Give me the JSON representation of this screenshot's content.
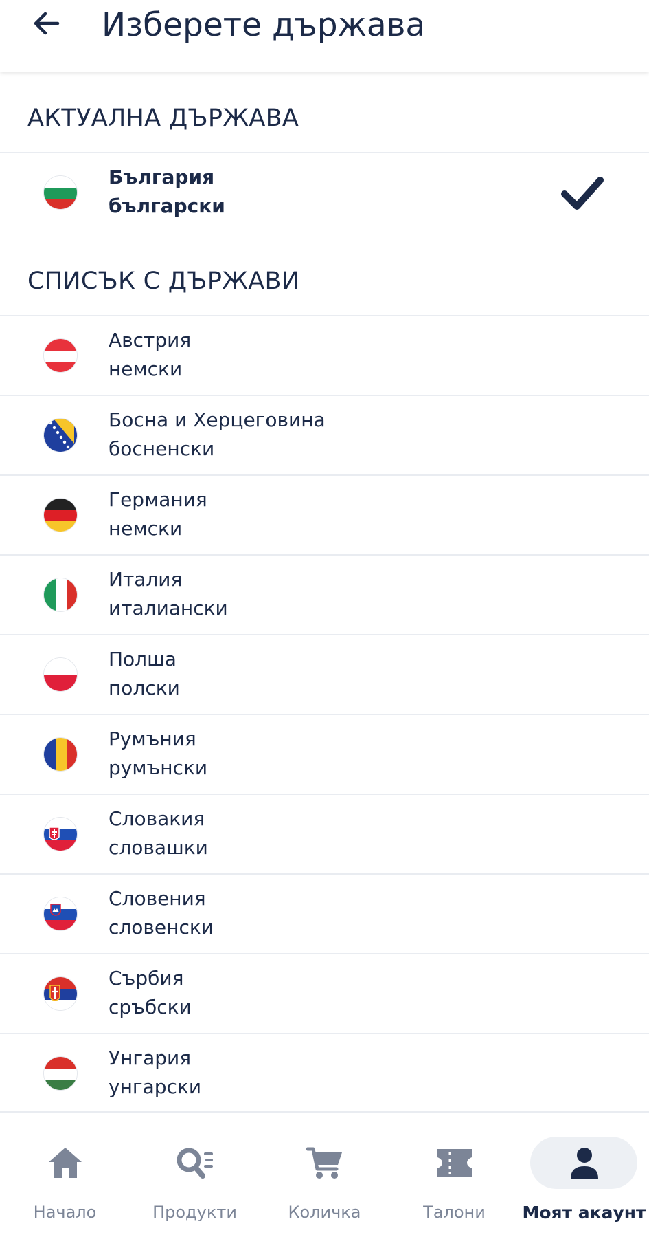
{
  "header": {
    "title": "Изберете държава",
    "back_icon": "arrow-left-icon"
  },
  "current_section": {
    "title": "АКТУАЛНА ДЪРЖАВА",
    "country": {
      "name": "България",
      "language": "български",
      "flag": "flag-bulgaria-icon",
      "selected_icon": "checkmark-icon"
    }
  },
  "list_section": {
    "title": "СПИСЪК С ДЪРЖАВИ",
    "countries": [
      {
        "name": "Австрия",
        "language": "немски",
        "flag": "flag-austria-icon"
      },
      {
        "name": "Босна и Херцеговина",
        "language": "босненски",
        "flag": "flag-bosnia-icon"
      },
      {
        "name": "Германия",
        "language": "немски",
        "flag": "flag-germany-icon"
      },
      {
        "name": "Италия",
        "language": "италиански",
        "flag": "flag-italy-icon"
      },
      {
        "name": "Полша",
        "language": "полски",
        "flag": "flag-poland-icon"
      },
      {
        "name": "Румъния",
        "language": "румънски",
        "flag": "flag-romania-icon"
      },
      {
        "name": "Словакия",
        "language": "словашки",
        "flag": "flag-slovakia-icon"
      },
      {
        "name": "Словения",
        "language": "словенски",
        "flag": "flag-slovenia-icon"
      },
      {
        "name": "Сърбия",
        "language": "сръбски",
        "flag": "flag-serbia-icon"
      },
      {
        "name": "Унгария",
        "language": "унгарски",
        "flag": "flag-hungary-icon"
      }
    ]
  },
  "bottom_nav": {
    "items": [
      {
        "label": "Начало",
        "icon": "home-icon"
      },
      {
        "label": "Продукти",
        "icon": "product-search-icon"
      },
      {
        "label": "Количка",
        "icon": "cart-icon"
      },
      {
        "label": "Талони",
        "icon": "coupon-icon"
      },
      {
        "label": "Моят акаунт",
        "icon": "user-icon",
        "active": true
      }
    ]
  },
  "colors": {
    "text": "#1c2a48",
    "muted": "#7c8597",
    "divider": "#e9ecf1",
    "active_pill": "#edf0f4"
  }
}
